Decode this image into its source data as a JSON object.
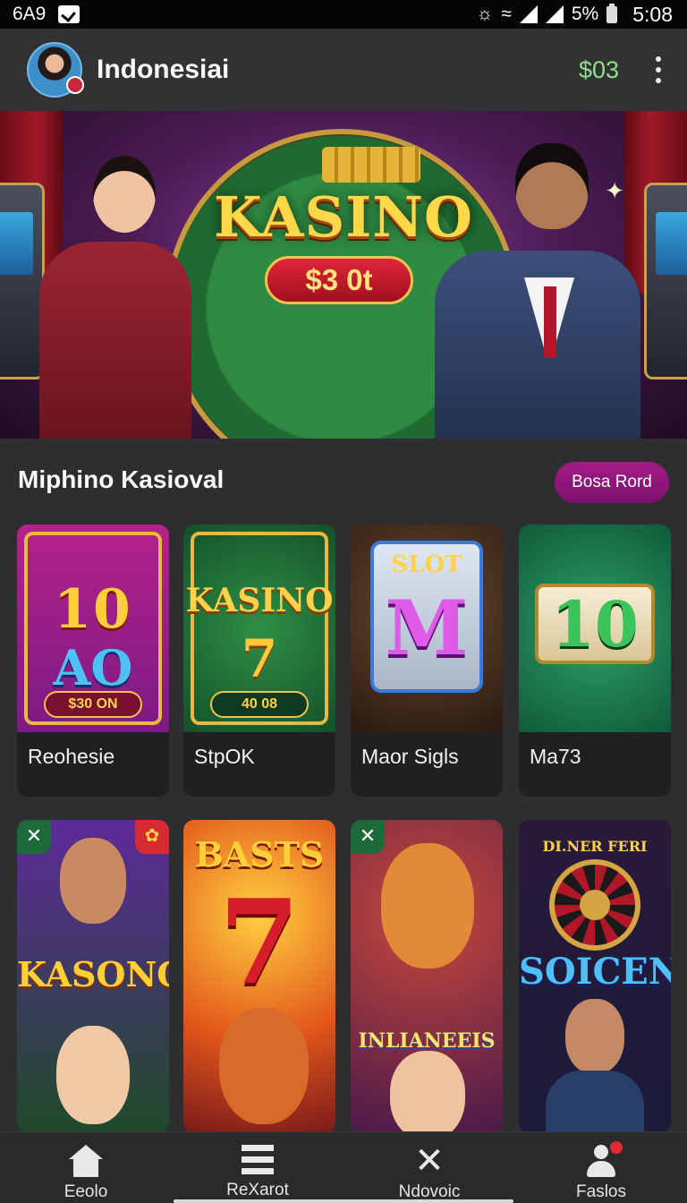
{
  "status_bar": {
    "left_text": "6A9",
    "right_battery_text": "5%",
    "time": "5:08"
  },
  "header": {
    "title": "Indonesiai",
    "balance": "$03"
  },
  "hero": {
    "title": "KASINO",
    "pill_text": "$3 0t"
  },
  "section": {
    "title": "Miphino Kasioval",
    "button_label": "Bosa Rord"
  },
  "games_row1": [
    {
      "name": "Reohesie",
      "tile_top": "10",
      "tile_bottom": "AO",
      "pill": "$30 ON"
    },
    {
      "name": "StpOK",
      "tile_top": "KASINO",
      "tile_bottom": "7",
      "pill": "40 08"
    },
    {
      "name": "Maor Sigls",
      "tile_top": "SLOT",
      "tile_bottom": "M"
    },
    {
      "name": "Ma73",
      "tile_top": "10"
    }
  ],
  "games_row2": [
    {
      "tile_text": "KASONO"
    },
    {
      "tile_top": "BASTS",
      "tile_bottom": "7"
    },
    {
      "tile_text": "INLIANEEIS"
    },
    {
      "tile_top": "DI.NER FERI",
      "tile_bottom": "SOICEN"
    }
  ],
  "bottom_nav": [
    {
      "label": "Eeolo",
      "icon": "home-icon"
    },
    {
      "label": "ReXarot",
      "icon": "list-icon"
    },
    {
      "label": "Ndovoic",
      "icon": "close-icon"
    },
    {
      "label": "Faslos",
      "icon": "user-icon"
    }
  ],
  "colors": {
    "accent": "#a31c8a",
    "balance": "#8fe08a",
    "background": "#2e2d2f"
  }
}
